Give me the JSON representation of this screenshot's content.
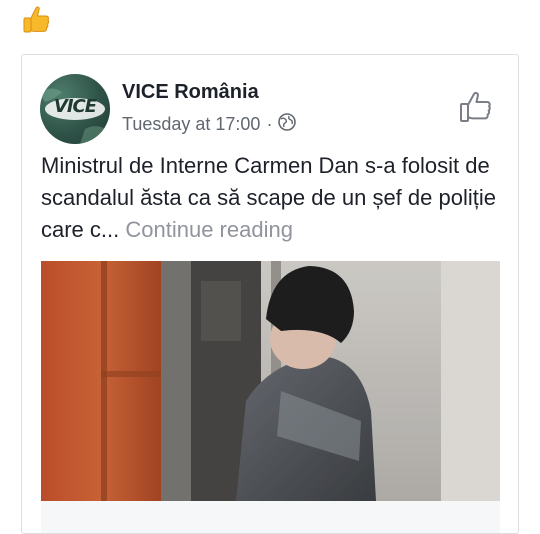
{
  "reaction": {
    "icon": "thumbs-up-emoji"
  },
  "post": {
    "page_name": "VICE România",
    "timestamp": "Tuesday at 17:00",
    "separator": "·",
    "privacy_icon": "globe-icon",
    "avatar_logo": "VICE",
    "like_icon": "thumb-up-outline-icon",
    "text": "Ministrul de Interne Carmen Dan s-a folosit de scandalul ăsta ca să scape de un șef de poliție care c...",
    "more_label": "Continue reading"
  },
  "link_preview": {
    "image_description_icon": "cctv-photo",
    "title_partial": ""
  },
  "colors": {
    "text": "#1d2129",
    "meta": "#616770",
    "more": "#90949c",
    "border": "#dddfe2"
  }
}
